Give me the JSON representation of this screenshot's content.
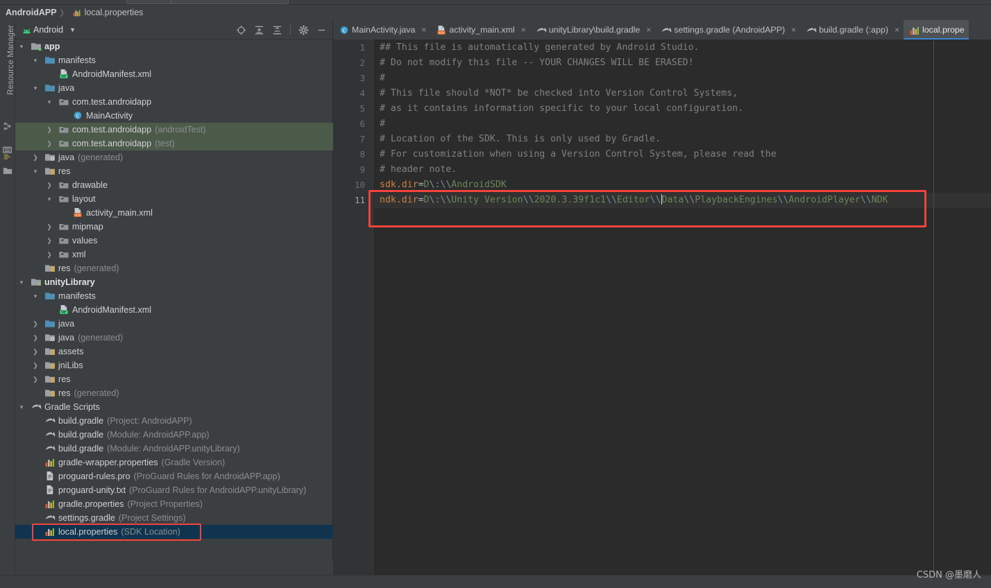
{
  "breadcrumb": {
    "root": "AndroidAPP",
    "separator": "〉",
    "file": "local.properties",
    "file_icon": "properties-icon"
  },
  "left_rail": {
    "label": "Resource Manager",
    "icons": [
      "structure-icon",
      "build-variants-icon",
      "favorites-icon"
    ]
  },
  "project_panel": {
    "title": "Android",
    "android_icon": "android-head-icon",
    "caret_icon": "chevron-down-icon",
    "tools": [
      {
        "name": "locate-icon",
        "tip": "Select Opened File"
      },
      {
        "name": "expand-all-icon",
        "tip": "Expand All"
      },
      {
        "name": "collapse-all-icon",
        "tip": "Collapse All"
      },
      {
        "name": "gear-icon",
        "tip": "Settings"
      },
      {
        "name": "minimize-icon",
        "tip": "Hide"
      }
    ]
  },
  "tree": [
    {
      "indent": 0,
      "arrow": "down",
      "icon": "module-icon",
      "label": "app",
      "sub": "",
      "bold": true,
      "state": "none"
    },
    {
      "indent": 1,
      "arrow": "down",
      "icon": "folder-icon",
      "label": "manifests",
      "sub": "",
      "bold": false,
      "state": "none"
    },
    {
      "indent": 2,
      "arrow": "none",
      "icon": "manifest-file-icon",
      "label": "AndroidManifest.xml",
      "sub": "",
      "bold": false,
      "state": "none"
    },
    {
      "indent": 1,
      "arrow": "down",
      "icon": "folder-icon",
      "label": "java",
      "sub": "",
      "bold": false,
      "state": "none"
    },
    {
      "indent": 2,
      "arrow": "down",
      "icon": "package-icon",
      "label": "com.test.androidapp",
      "sub": "",
      "bold": false,
      "state": "none"
    },
    {
      "indent": 3,
      "arrow": "none",
      "icon": "class-icon",
      "label": "MainActivity",
      "sub": "",
      "bold": false,
      "state": "none"
    },
    {
      "indent": 2,
      "arrow": "right",
      "icon": "package-icon",
      "label": "com.test.androidapp",
      "sub": "(androidTest)",
      "bold": false,
      "state": "green"
    },
    {
      "indent": 2,
      "arrow": "right",
      "icon": "package-icon",
      "label": "com.test.androidapp",
      "sub": "(test)",
      "bold": false,
      "state": "green"
    },
    {
      "indent": 1,
      "arrow": "right",
      "icon": "folder-gen-icon",
      "label": "java",
      "sub": "(generated)",
      "bold": false,
      "state": "none"
    },
    {
      "indent": 1,
      "arrow": "down",
      "icon": "res-folder-icon",
      "label": "res",
      "sub": "",
      "bold": false,
      "state": "none"
    },
    {
      "indent": 2,
      "arrow": "right",
      "icon": "package-icon",
      "label": "drawable",
      "sub": "",
      "bold": false,
      "state": "none"
    },
    {
      "indent": 2,
      "arrow": "down",
      "icon": "package-icon",
      "label": "layout",
      "sub": "",
      "bold": false,
      "state": "none"
    },
    {
      "indent": 3,
      "arrow": "none",
      "icon": "layout-file-icon",
      "label": "activity_main.xml",
      "sub": "",
      "bold": false,
      "state": "none"
    },
    {
      "indent": 2,
      "arrow": "right",
      "icon": "package-icon",
      "label": "mipmap",
      "sub": "",
      "bold": false,
      "state": "none"
    },
    {
      "indent": 2,
      "arrow": "right",
      "icon": "package-icon",
      "label": "values",
      "sub": "",
      "bold": false,
      "state": "none"
    },
    {
      "indent": 2,
      "arrow": "right",
      "icon": "package-icon",
      "label": "xml",
      "sub": "",
      "bold": false,
      "state": "none"
    },
    {
      "indent": 1,
      "arrow": "none",
      "icon": "res-folder-icon",
      "label": "res",
      "sub": "(generated)",
      "bold": false,
      "state": "none"
    },
    {
      "indent": 0,
      "arrow": "down",
      "icon": "library-icon",
      "label": "unityLibrary",
      "sub": "",
      "bold": true,
      "state": "none"
    },
    {
      "indent": 1,
      "arrow": "down",
      "icon": "folder-icon",
      "label": "manifests",
      "sub": "",
      "bold": false,
      "state": "none"
    },
    {
      "indent": 2,
      "arrow": "none",
      "icon": "manifest-file-icon",
      "label": "AndroidManifest.xml",
      "sub": "",
      "bold": false,
      "state": "none"
    },
    {
      "indent": 1,
      "arrow": "right",
      "icon": "folder-icon",
      "label": "java",
      "sub": "",
      "bold": false,
      "state": "none"
    },
    {
      "indent": 1,
      "arrow": "right",
      "icon": "folder-gen-icon",
      "label": "java",
      "sub": "(generated)",
      "bold": false,
      "state": "none"
    },
    {
      "indent": 1,
      "arrow": "right",
      "icon": "res-folder-icon",
      "label": "assets",
      "sub": "",
      "bold": false,
      "state": "none"
    },
    {
      "indent": 1,
      "arrow": "right",
      "icon": "res-folder-icon",
      "label": "jniLibs",
      "sub": "",
      "bold": false,
      "state": "none"
    },
    {
      "indent": 1,
      "arrow": "right",
      "icon": "res-folder-icon",
      "label": "res",
      "sub": "",
      "bold": false,
      "state": "none"
    },
    {
      "indent": 1,
      "arrow": "none",
      "icon": "res-folder-icon",
      "label": "res",
      "sub": "(generated)",
      "bold": false,
      "state": "none"
    },
    {
      "indent": 0,
      "arrow": "down",
      "icon": "gradle-icon",
      "label": "Gradle Scripts",
      "sub": "",
      "bold": false,
      "state": "none"
    },
    {
      "indent": 1,
      "arrow": "none",
      "icon": "gradle-icon",
      "label": "build.gradle",
      "sub": "(Project: AndroidAPP)",
      "bold": false,
      "state": "none"
    },
    {
      "indent": 1,
      "arrow": "none",
      "icon": "gradle-icon",
      "label": "build.gradle",
      "sub": "(Module: AndroidAPP.app)",
      "bold": false,
      "state": "none"
    },
    {
      "indent": 1,
      "arrow": "none",
      "icon": "gradle-icon",
      "label": "build.gradle",
      "sub": "(Module: AndroidAPP.unityLibrary)",
      "bold": false,
      "state": "none"
    },
    {
      "indent": 1,
      "arrow": "none",
      "icon": "properties-icon",
      "label": "gradle-wrapper.properties",
      "sub": "(Gradle Version)",
      "bold": false,
      "state": "none"
    },
    {
      "indent": 1,
      "arrow": "none",
      "icon": "text-file-icon",
      "label": "proguard-rules.pro",
      "sub": "(ProGuard Rules for AndroidAPP.app)",
      "bold": false,
      "state": "none"
    },
    {
      "indent": 1,
      "arrow": "none",
      "icon": "text-file-icon",
      "label": "proguard-unity.txt",
      "sub": "(ProGuard Rules for AndroidAPP.unityLibrary)",
      "bold": false,
      "state": "none"
    },
    {
      "indent": 1,
      "arrow": "none",
      "icon": "properties-icon",
      "label": "gradle.properties",
      "sub": "(Project Properties)",
      "bold": false,
      "state": "none"
    },
    {
      "indent": 1,
      "arrow": "none",
      "icon": "gradle-icon",
      "label": "settings.gradle",
      "sub": "(Project Settings)",
      "bold": false,
      "state": "none"
    },
    {
      "indent": 1,
      "arrow": "none",
      "icon": "properties-icon",
      "label": "local.properties",
      "sub": "(SDK Location)",
      "bold": false,
      "state": "selected"
    }
  ],
  "editor_tabs": [
    {
      "label": "MainActivity.java",
      "icon": "class-icon",
      "active": false,
      "close": "×"
    },
    {
      "label": "activity_main.xml",
      "icon": "layout-file-icon",
      "active": false,
      "close": "×"
    },
    {
      "label": "unityLibrary\\build.gradle",
      "icon": "gradle-icon",
      "active": false,
      "close": "×"
    },
    {
      "label": "settings.gradle (AndroidAPP)",
      "icon": "gradle-icon",
      "active": false,
      "close": "×"
    },
    {
      "label": "build.gradle (:app)",
      "icon": "gradle-icon",
      "active": false,
      "close": "×"
    },
    {
      "label": "local.prope",
      "icon": "properties-icon",
      "active": true,
      "close": ""
    }
  ],
  "code": {
    "line_numbers": [
      "1",
      "2",
      "3",
      "4",
      "5",
      "6",
      "7",
      "8",
      "9",
      "10",
      "11"
    ],
    "current_line": 11,
    "lines": [
      {
        "n": 1,
        "type": "comment",
        "text": "## This file is automatically generated by Android Studio."
      },
      {
        "n": 2,
        "type": "comment",
        "text": "# Do not modify this file -- YOUR CHANGES WILL BE ERASED!"
      },
      {
        "n": 3,
        "type": "comment",
        "text": "#"
      },
      {
        "n": 4,
        "type": "comment",
        "text": "# This file should *NOT* be checked into Version Control Systems,"
      },
      {
        "n": 5,
        "type": "comment",
        "text": "# as it contains information specific to your local configuration."
      },
      {
        "n": 6,
        "type": "comment",
        "text": "#"
      },
      {
        "n": 7,
        "type": "comment",
        "text": "# Location of the SDK. This is only used by Gradle."
      },
      {
        "n": 8,
        "type": "comment",
        "text": "# For customization when using a Version Control System, please read the"
      },
      {
        "n": 9,
        "type": "comment",
        "text": "# header note."
      },
      {
        "n": 10,
        "type": "property",
        "key": "sdk.dir",
        "value": "D\\:\\\\AndroidSDK"
      },
      {
        "n": 11,
        "type": "property",
        "key": "ndk.dir",
        "value": "D\\:\\\\Unity Version\\\\2020.3.39f1c1\\\\Editor\\\\Data\\\\PlaybackEngines\\\\AndroidPlayer\\\\NDK"
      }
    ]
  },
  "annotations": [
    {
      "name": "code-highlight-box",
      "color": "#f4433b",
      "target": "ndk.dir line"
    },
    {
      "name": "tree-highlight-box",
      "color": "#f4433b",
      "target": "local.properties (SDK Location)"
    }
  ],
  "watermark": "CSDN @墨磨人",
  "colors": {
    "panel_bg": "#3c3f41",
    "editor_bg": "#2b2b2b",
    "gutter_bg": "#313335",
    "tab_active_bg": "#4e5254",
    "tab_underline": "#3a84cf",
    "selection_blue": "#10344f",
    "highlight_green": "#4c5a4a",
    "comment": "#808080",
    "key": "#cc8242",
    "value": "#6a8759",
    "escape": "#7a8c9e",
    "annotation_red": "#f4433b"
  }
}
